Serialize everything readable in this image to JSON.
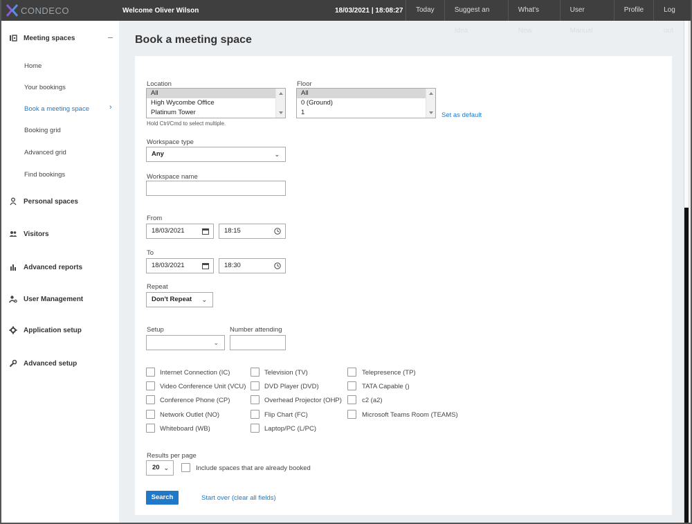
{
  "app": {
    "logo_text": "CONDECO",
    "welcome": "Welcome Oliver Wilson",
    "datetime": "18/03/2021 | 18:08:27",
    "nav": [
      "Today",
      "Suggest an Idea",
      "What's New",
      "User Manual",
      "Profile",
      "Log out"
    ]
  },
  "sidebar": {
    "meeting_spaces": "Meeting spaces",
    "items": [
      "Home",
      "Your bookings",
      "Book a meeting space",
      "Booking grid",
      "Advanced grid",
      "Find bookings"
    ],
    "groups": [
      "Personal spaces",
      "Visitors",
      "Advanced reports",
      "User Management",
      "Application setup",
      "Advanced setup"
    ]
  },
  "main": {
    "title": "Book a meeting space",
    "location_label": "Location",
    "location_options": [
      "All",
      "High Wycombe Office",
      "Platinum Tower"
    ],
    "location_hint": "Hold Ctrl/Cmd to select multiple.",
    "floor_label": "Floor",
    "floor_options": [
      "All",
      "0 (Ground)",
      "1"
    ],
    "set_default": "Set as default",
    "workspace_type_label": "Workspace type",
    "workspace_type_value": "Any",
    "workspace_name_label": "Workspace name",
    "workspace_name_value": "",
    "from_label": "From",
    "from_date": "18/03/2021",
    "from_time": "18:15",
    "to_label": "To",
    "to_date": "18/03/2021",
    "to_time": "18:30",
    "repeat_label": "Repeat",
    "repeat_value": "Don't Repeat",
    "setup_label": "Setup",
    "setup_value": "",
    "attending_label": "Number attending",
    "attending_value": "",
    "facilities_col1": [
      "Internet Connection (IC)",
      "Video Conference Unit (VCU)",
      "Conference Phone (CP)",
      "Network Outlet (NO)",
      "Whiteboard (WB)"
    ],
    "facilities_col2": [
      "Television (TV)",
      "DVD Player (DVD)",
      "Overhead Projector (OHP)",
      "Flip Chart (FC)",
      "Laptop/PC (L/PC)"
    ],
    "facilities_col3": [
      "Telepresence (TP)",
      "TATA Capable ()",
      "c2 (a2)",
      "Microsoft Teams Room (TEAMS)"
    ],
    "results_label": "Results per page",
    "results_value": "20",
    "include_booked": "Include spaces that are already booked",
    "search_button": "Search",
    "start_over": "Start over (clear all fields)"
  },
  "colors": {
    "accent": "#1f78c8",
    "topbar": "#3f3f3f",
    "logo_x": "#7b57c9"
  }
}
